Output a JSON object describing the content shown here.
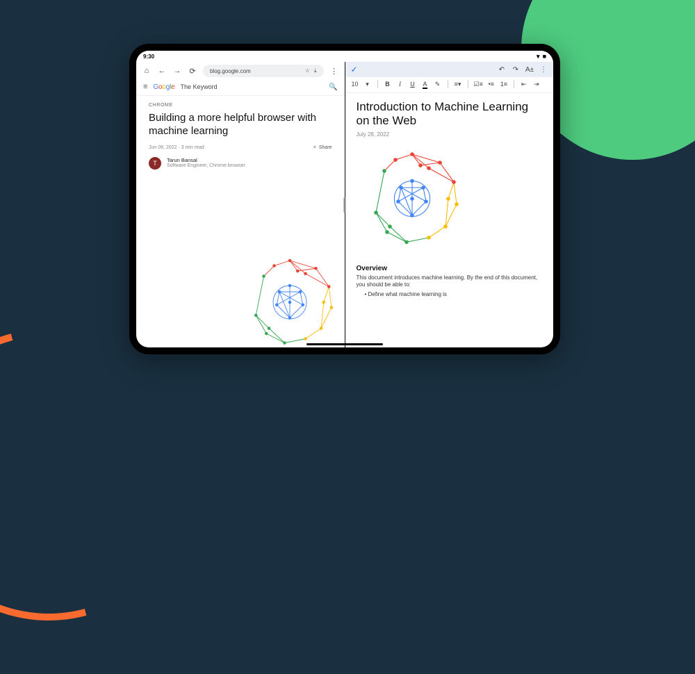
{
  "statusbar": {
    "time": "9:30"
  },
  "browser": {
    "url": "blog.google.com",
    "site_title": "The Keyword",
    "article": {
      "eyebrow": "CHROME",
      "headline": "Building a more helpful browser with machine learning",
      "date": "Jun 09, 2022",
      "read_time": "3 min read",
      "share_label": "Share",
      "author_initial": "T",
      "author_name": "Tarun Bansal",
      "author_role": "Software Engineer, Chrome browser"
    }
  },
  "doc": {
    "font_size": "10",
    "tool_text_size_label": "A±",
    "title": "Introduction to Machine Learning on the Web",
    "date": "July 28, 2022",
    "overview_heading": "Overview",
    "overview_body": "This document introduces machine learning. By the end of this document, you should be able to:",
    "bullet1": "Define what machine learning is"
  }
}
